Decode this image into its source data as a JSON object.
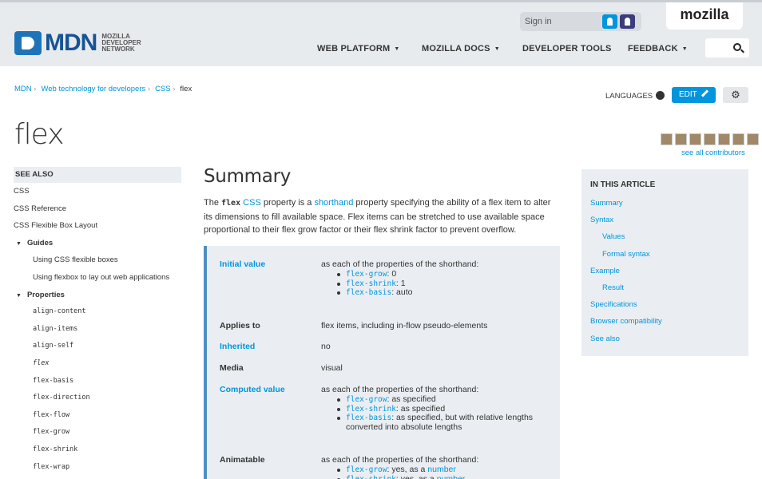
{
  "brand": {
    "logo_text": "MDN",
    "logo_subtext": "MOZILLA DEVELOPER NETWORK",
    "mozilla_tab": "mozilla"
  },
  "signin": {
    "label": "Sign in",
    "persona_icon": "person-icon",
    "github_icon": "github-icon"
  },
  "nav": [
    {
      "label": "WEB PLATFORM",
      "dropdown": true
    },
    {
      "label": "MOZILLA DOCS",
      "dropdown": true
    },
    {
      "label": "DEVELOPER TOOLS",
      "dropdown": false
    },
    {
      "label": "FEEDBACK",
      "dropdown": true
    }
  ],
  "search": {
    "icon": "search-icon"
  },
  "breadcrumb": [
    "MDN",
    "Web technology for developers",
    "CSS",
    "flex"
  ],
  "actions": {
    "languages": "LANGUAGES",
    "edit": "EDIT",
    "settings_icon": "gear-icon"
  },
  "page": {
    "title": "flex",
    "contributors_link": "see all contributors"
  },
  "sidebar": {
    "see_also": "SEE ALSO",
    "items": [
      {
        "label": "CSS",
        "type": "lvl1"
      },
      {
        "label": "CSS Reference",
        "type": "lvl1"
      },
      {
        "label": "CSS Flexible Box Layout",
        "type": "lvl1"
      },
      {
        "label": "Guides",
        "type": "lvl2"
      },
      {
        "label": "Using CSS flexible boxes",
        "type": "lvl3"
      },
      {
        "label": "Using flexbox to lay out web applications",
        "type": "lvl3"
      },
      {
        "label": "Properties",
        "type": "lvl2"
      },
      {
        "label": "align-content",
        "type": "code"
      },
      {
        "label": "align-items",
        "type": "code"
      },
      {
        "label": "align-self",
        "type": "code"
      },
      {
        "label": "flex",
        "type": "code current"
      },
      {
        "label": "flex-basis",
        "type": "code"
      },
      {
        "label": "flex-direction",
        "type": "code"
      },
      {
        "label": "flex-flow",
        "type": "code"
      },
      {
        "label": "flex-grow",
        "type": "code"
      },
      {
        "label": "flex-shrink",
        "type": "code"
      },
      {
        "label": "flex-wrap",
        "type": "code"
      }
    ]
  },
  "summary": {
    "heading": "Summary",
    "p_the": "The ",
    "p_code": "flex",
    "p_css": "CSS",
    "p_mid": " property is a ",
    "p_shorthand": "shorthand",
    "p_rest": " property specifying the ability of a flex item to alter its dimensions to fill available space. Flex items can be stretched to use available space proportional to their flex grow factor or their flex shrink factor to prevent overflow."
  },
  "props": {
    "initial": {
      "key": "Initial value",
      "value": "as each of the properties of the shorthand:",
      "items": [
        {
          "code": "flex-grow",
          "rest": ": 0"
        },
        {
          "code": "flex-shrink",
          "rest": ": 1"
        },
        {
          "code": "flex-basis",
          "rest": ": auto"
        }
      ]
    },
    "applies": {
      "key": "Applies to",
      "value": "flex items, including in-flow pseudo-elements"
    },
    "inherited": {
      "key": "Inherited",
      "value": "no"
    },
    "media": {
      "key": "Media",
      "value": "visual"
    },
    "computed": {
      "key": "Computed value",
      "value": "as each of the properties of the shorthand:",
      "items": [
        {
          "code": "flex-grow",
          "rest": ": as specified"
        },
        {
          "code": "flex-shrink",
          "rest": ": as specified"
        },
        {
          "code": "flex-basis",
          "rest": ": as specified, but with relative lengths converted into absolute lengths"
        }
      ]
    },
    "animatable": {
      "key": "Animatable",
      "value": "as each of the properties of the shorthand:",
      "items": [
        {
          "code": "flex-grow",
          "rest": ": yes, as a ",
          "link": "number"
        },
        {
          "code": "flex-shrink",
          "rest": ": yes, as a ",
          "link": "number"
        }
      ]
    }
  },
  "toc": {
    "heading": "IN THIS ARTICLE",
    "items": [
      {
        "label": "Summary",
        "sub": false
      },
      {
        "label": "Syntax",
        "sub": false
      },
      {
        "label": "Values",
        "sub": true
      },
      {
        "label": "Formal syntax",
        "sub": true
      },
      {
        "label": "Example",
        "sub": false
      },
      {
        "label": "Result",
        "sub": true
      },
      {
        "label": "Specifications",
        "sub": false
      },
      {
        "label": "Browser compatibility",
        "sub": false
      },
      {
        "label": "See also",
        "sub": false
      }
    ]
  },
  "colors": {
    "accent": "#0095dd",
    "header_bg": "#e8ebee",
    "panel_bg": "#eaeef2",
    "props_border": "#4d8fc4"
  }
}
